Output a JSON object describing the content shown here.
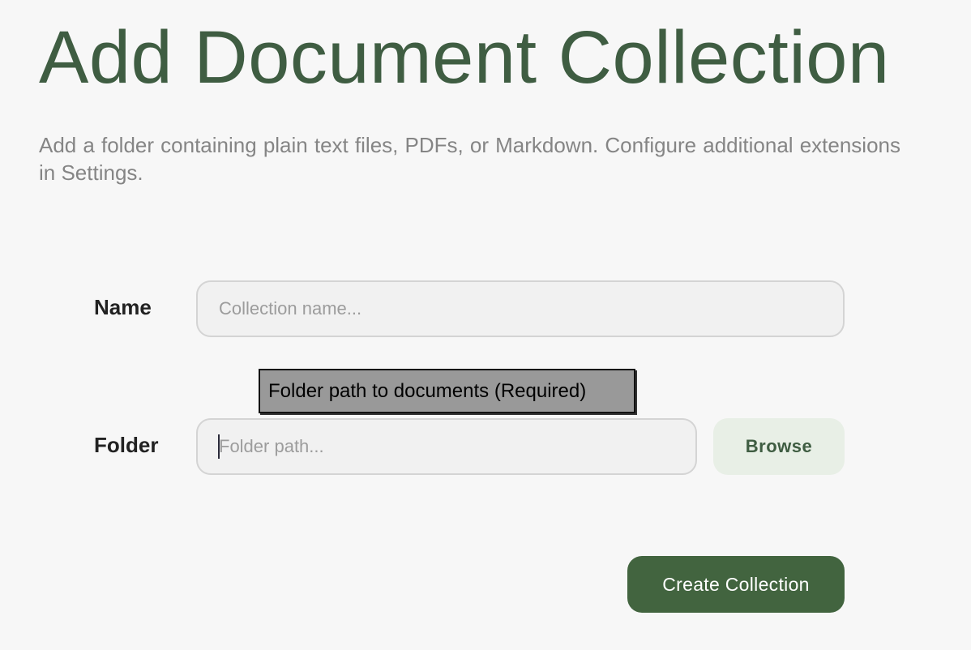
{
  "page": {
    "title": "Add Document Collection",
    "description": "Add a folder containing plain text files, PDFs, or Markdown. Configure additional extensions in Settings."
  },
  "form": {
    "name_label": "Name",
    "name_placeholder": "Collection name...",
    "name_value": "",
    "folder_label": "Folder",
    "folder_placeholder": "Folder path...",
    "folder_value": "",
    "folder_tooltip": "Folder path to documents (Required)",
    "browse_label": "Browse",
    "submit_label": "Create Collection"
  },
  "colors": {
    "accent": "#42643f",
    "title": "#3f5d42",
    "browse_bg": "#e8efe6",
    "background": "#f7f7f7",
    "tooltip_bg": "#999999"
  }
}
